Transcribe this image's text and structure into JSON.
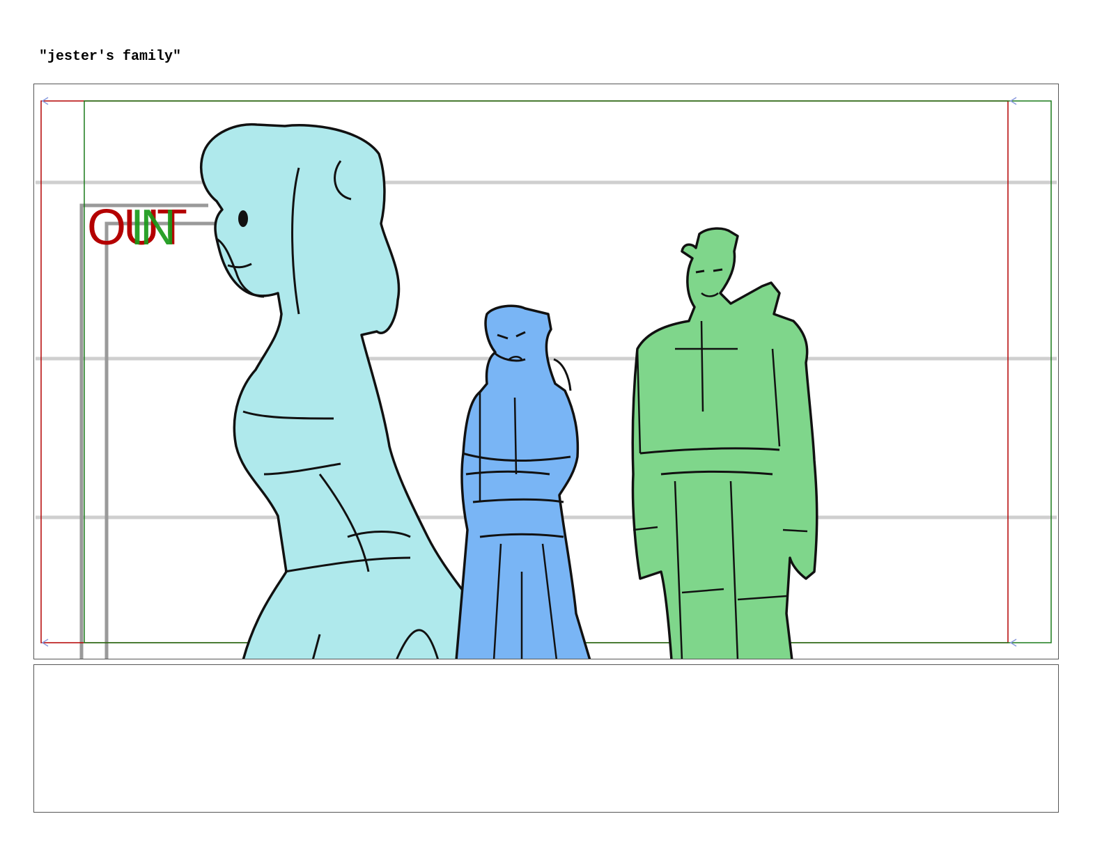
{
  "scene": {
    "title": "\"jester's family\""
  },
  "frame_markers": {
    "out_label": "OUT",
    "in_label": "IN",
    "out_color": "#b40000",
    "in_color": "#1a9a1a"
  },
  "colors": {
    "jester_fill": "#afe9ec",
    "mother_fill": "#79b5f5",
    "guard_fill": "#7fd68b",
    "guide_lines": "#cfcfcf",
    "door_lines": "#9a9a9a",
    "out_frame": "#b40000",
    "in_frame": "#1a7a1a"
  },
  "notes": {
    "text": ""
  }
}
